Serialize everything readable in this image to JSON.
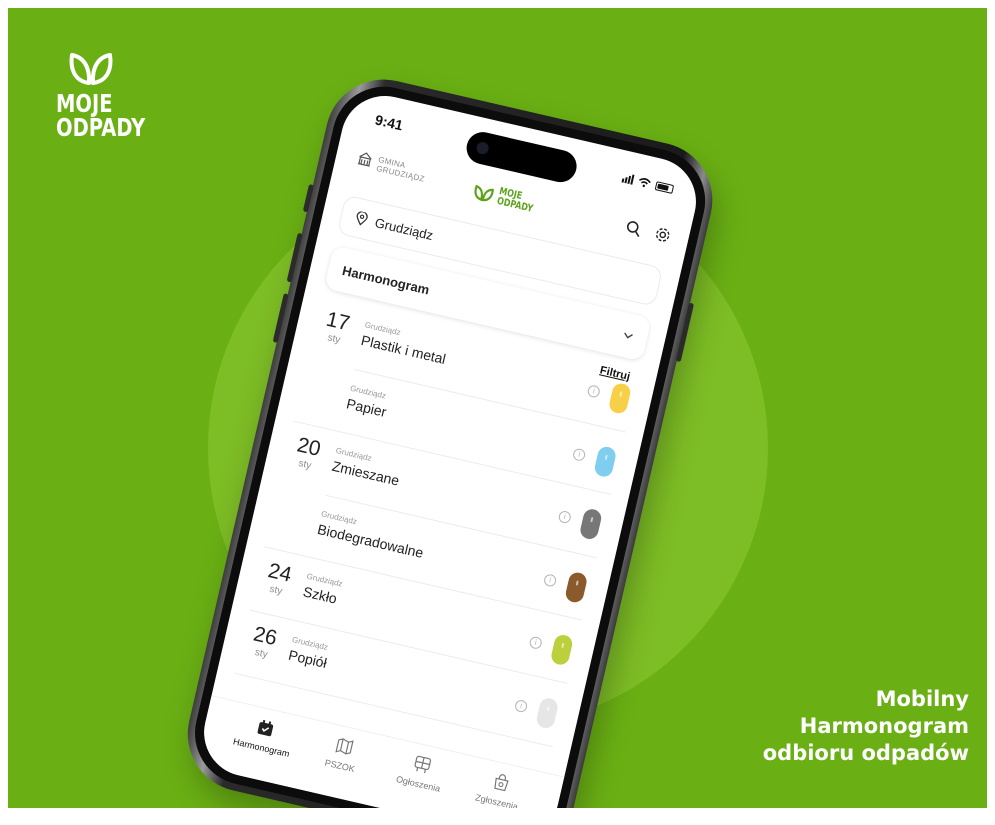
{
  "brand": {
    "line1": "MOJE",
    "line2": "ODPADY"
  },
  "tagline": {
    "line1": "Mobilny",
    "line2": "Harmonogram",
    "line3": "odbioru odpadów"
  },
  "phone": {
    "time": "9:41",
    "gmina": {
      "line1": "GMINA",
      "line2": "GRUDZIĄDZ"
    },
    "logo": {
      "line1": "MOJE",
      "line2": "ODPADY"
    },
    "location": "Grudziądz",
    "section_title": "Harmonogram",
    "filter_label": "Filtruj",
    "schedule": [
      {
        "day": "17",
        "month": "sty",
        "items": [
          {
            "location": "Grudziądz",
            "type": "Plastik i metal",
            "color": "#f7d048"
          },
          {
            "location": "Grudziądz",
            "type": "Papier",
            "color": "#7fcdef"
          }
        ]
      },
      {
        "day": "20",
        "month": "sty",
        "items": [
          {
            "location": "Grudziądz",
            "type": "Zmieszane",
            "color": "#777777"
          },
          {
            "location": "Grudziądz",
            "type": "Biodegradowalne",
            "color": "#8a5a2b"
          }
        ]
      },
      {
        "day": "24",
        "month": "sty",
        "items": [
          {
            "location": "Grudziądz",
            "type": "Szkło",
            "color": "#bccf3c"
          }
        ]
      },
      {
        "day": "26",
        "month": "sty",
        "items": [
          {
            "location": "Grudziądz",
            "type": "Popiół",
            "color": "#e6e6e6"
          }
        ]
      }
    ],
    "tabs": [
      {
        "label": "Harmonogram",
        "icon": "calendar-icon",
        "active": true
      },
      {
        "label": "PSZOK",
        "icon": "map-icon",
        "active": false
      },
      {
        "label": "Ogłoszenia",
        "icon": "notice-board-icon",
        "active": false
      },
      {
        "label": "Zgłoszenia",
        "icon": "report-bag-icon",
        "active": false
      }
    ]
  },
  "colors": {
    "background": "#6ab014",
    "accent": "#5da31a"
  }
}
